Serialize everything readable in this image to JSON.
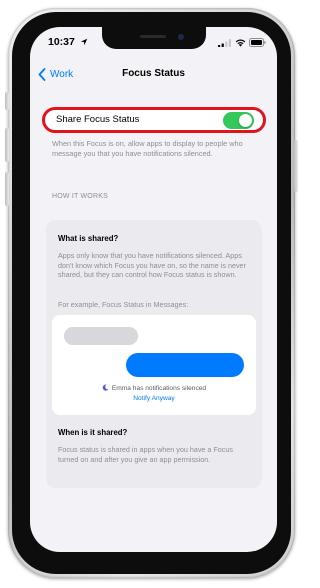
{
  "status_bar": {
    "time": "10:37",
    "icons": [
      "location-arrow-icon",
      "cellular-signal-icon",
      "wifi-icon",
      "battery-icon"
    ]
  },
  "navbar": {
    "back_label": "Work",
    "title": "Focus Status"
  },
  "toggle_row": {
    "label": "Share Focus Status",
    "enabled": true
  },
  "toggle_footer": "When this Focus is on, allow apps to display to people who message you that you have notifications silenced.",
  "section_header": "HOW IT WORKS",
  "info_card": {
    "what_heading": "What is shared?",
    "what_body": "Apps only know that you have notifications silenced. Apps don't know which Focus you have on, so the name is never shared, but they can control how Focus status is shown.",
    "example_label": "For example, Focus Status in Messages:",
    "preview": {
      "silenced_text": "Emma has notifications silenced",
      "notify_anyway": "Notify Anyway"
    },
    "when_heading": "When is it shared?",
    "when_body": "Focus status is shared in apps when you have a Focus turned on and after you give an app permission."
  },
  "colors": {
    "accent_blue": "#007aff",
    "toggle_green": "#34c759",
    "highlight_red": "#e0141e",
    "grouped_background": "#f2f2f7",
    "secondary_text": "#8e8e93",
    "incoming_bubble": "#d7d7dc"
  }
}
